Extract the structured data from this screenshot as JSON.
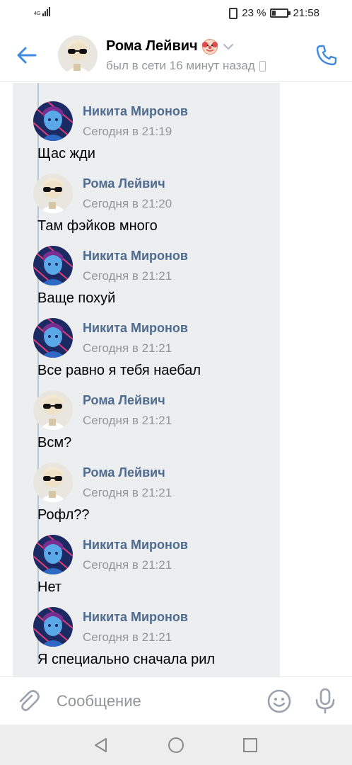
{
  "status_bar": {
    "network": "4G",
    "battery_percent_text": "23 %",
    "battery_level": 0.23,
    "time": "21:58"
  },
  "header": {
    "contact_name": "Рома Лейвич",
    "last_seen": "был в сети 16 минут назад",
    "back_icon": "arrow-left-icon",
    "call_icon": "phone-icon"
  },
  "messages": [
    {
      "author": "Никита Миронов",
      "time": "Сегодня в 21:19",
      "text": "Щас жди",
      "avatar": "nikita"
    },
    {
      "author": "Рома Лейвич",
      "time": "Сегодня в 21:20",
      "text": "Там фэйков много",
      "avatar": "roma"
    },
    {
      "author": "Никита Миронов",
      "time": "Сегодня в 21:21",
      "text": "Ваще похуй",
      "avatar": "nikita"
    },
    {
      "author": "Никита Миронов",
      "time": "Сегодня в 21:21",
      "text": "Все равно я тебя наебал",
      "avatar": "nikita"
    },
    {
      "author": "Рома Лейвич",
      "time": "Сегодня в 21:21",
      "text": "Всм?",
      "avatar": "roma"
    },
    {
      "author": "Рома Лейвич",
      "time": "Сегодня в 21:21",
      "text": "Рофл??",
      "avatar": "roma"
    },
    {
      "author": "Никита Миронов",
      "time": "Сегодня в 21:21",
      "text": "Нет",
      "avatar": "nikita"
    },
    {
      "author": "Никита Миронов",
      "time": "Сегодня в 21:21",
      "text": "Я специально сначала рил",
      "avatar": "nikita"
    }
  ],
  "input": {
    "placeholder": "Сообщение",
    "value": ""
  },
  "colors": {
    "accent": "#3f8ae0",
    "author_name": "#4f6c8f",
    "secondary_text": "#939699",
    "forward_background": "#edeef0"
  }
}
